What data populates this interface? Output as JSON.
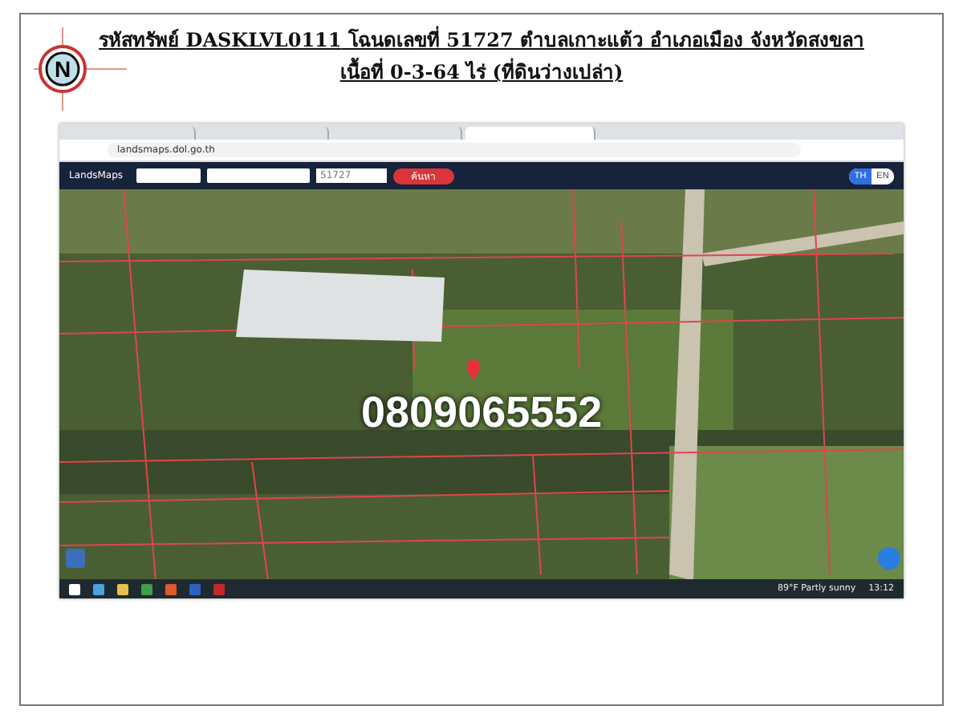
{
  "document": {
    "compass_letter": "N",
    "title_lines": [
      "รหัสทรัพย์ **DASKLVL0111** โฉนดเลขที่ 51727 ตำบลเกาะแต้ว อำเภอเมือง จังหวัดสงขลา",
      "เนื้อที่ 0-3-64 ไร่ (ที่ดินว่างเปล่า)"
    ]
  },
  "browser": {
    "tabs": [
      {
        "selected": false
      },
      {
        "selected": false
      },
      {
        "selected": false
      },
      {
        "selected": true
      }
    ],
    "address": "landsmaps.dol.go.th",
    "app": {
      "brand": "LandsMaps",
      "parcel_field": "51727",
      "search_button": "ค้นหา",
      "languages": [
        {
          "label": "TH",
          "selected": true
        },
        {
          "label": "EN",
          "selected": false
        }
      ]
    },
    "map": {
      "overlay_text": "0809065552"
    },
    "taskbar": {
      "weather": "89°F Partly sunny",
      "time": "13:12"
    }
  }
}
